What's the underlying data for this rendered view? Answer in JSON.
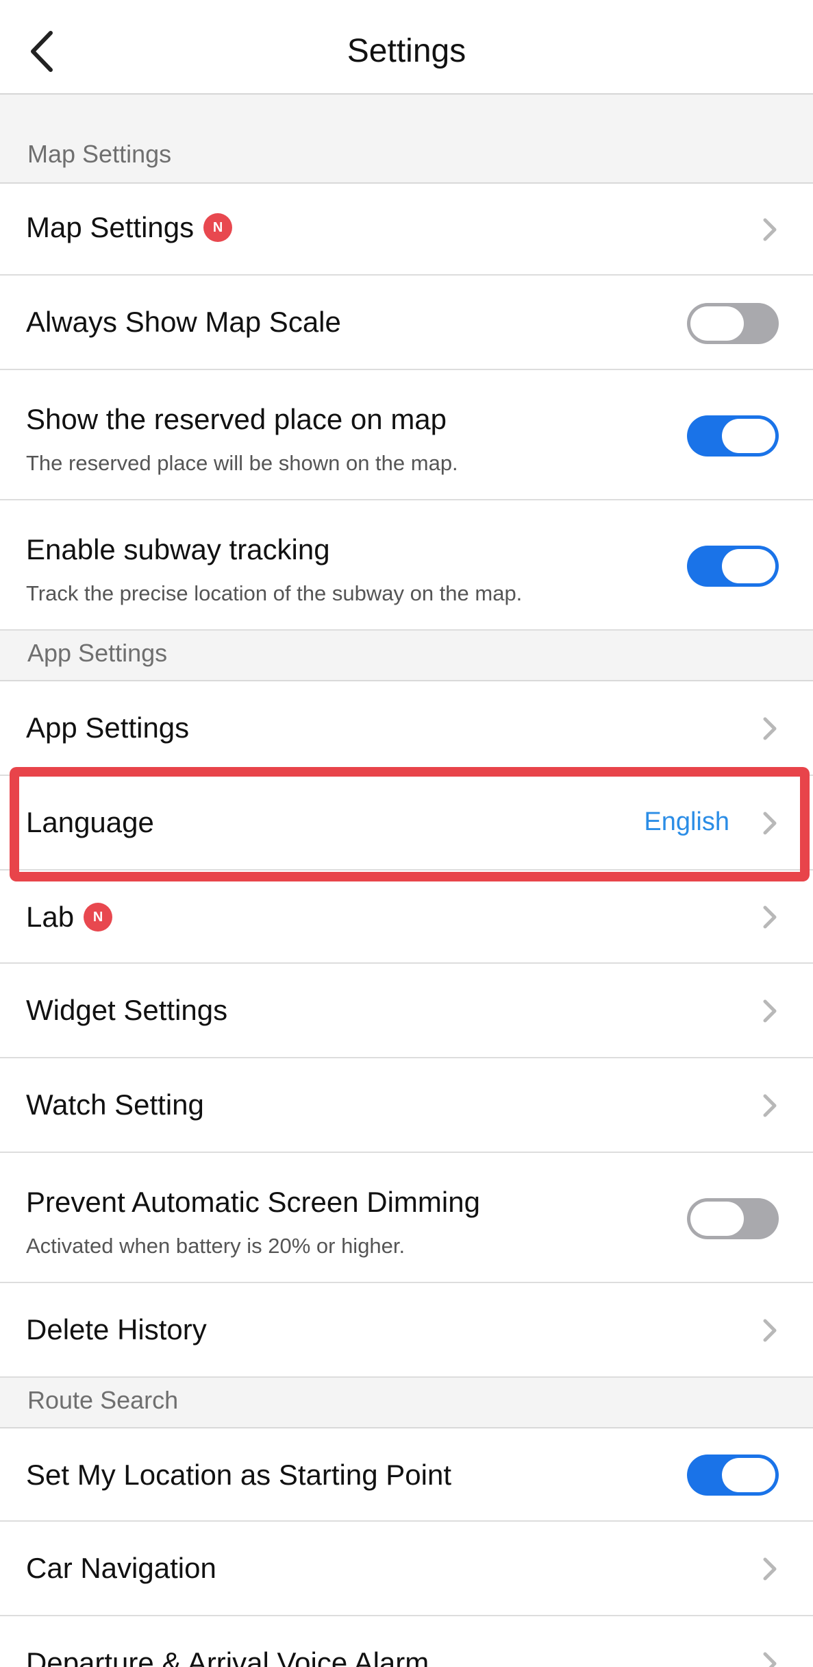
{
  "header": {
    "title": "Settings"
  },
  "sections": {
    "map": "Map Settings",
    "app": "App Settings",
    "route": "Route Search"
  },
  "rows": {
    "map_settings": {
      "label": "Map Settings",
      "badge": "N"
    },
    "map_scale": {
      "label": "Always Show Map Scale",
      "toggle": "off"
    },
    "reserved_place": {
      "label": "Show the reserved place on map",
      "sub": "The reserved place will be shown on the map.",
      "toggle": "on"
    },
    "subway_tracking": {
      "label": "Enable subway tracking",
      "sub": "Track the precise location of the subway on the map.",
      "toggle": "on"
    },
    "app_settings": {
      "label": "App Settings"
    },
    "language": {
      "label": "Language",
      "value": "English"
    },
    "lab": {
      "label": "Lab",
      "badge": "N"
    },
    "widget": {
      "label": "Widget Settings"
    },
    "watch": {
      "label": "Watch Setting"
    },
    "dimming": {
      "label": "Prevent Automatic Screen Dimming",
      "sub": "Activated when battery is 20% or higher.",
      "toggle": "off"
    },
    "delete_history": {
      "label": "Delete History"
    },
    "my_location": {
      "label": "Set My Location as Starting Point",
      "toggle": "on"
    },
    "car_navigation": {
      "label": "Car Navigation"
    },
    "voice_alarm": {
      "label": "Departure & Arrival Voice Alarm"
    }
  },
  "colors": {
    "accent": "#1a73e8",
    "value_text": "#2b8de6",
    "badge": "#e8484f",
    "highlight": "#e8444a"
  }
}
